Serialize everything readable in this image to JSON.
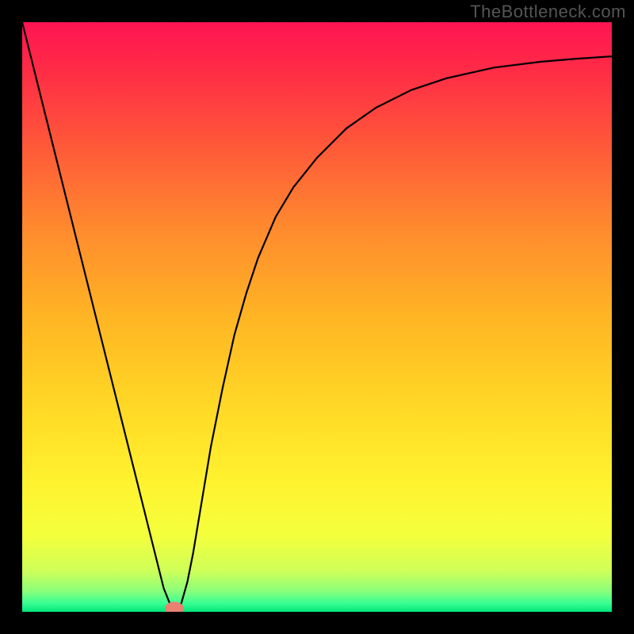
{
  "watermark": "TheBottleneck.com",
  "chart_data": {
    "type": "line",
    "title": "",
    "xlabel": "",
    "ylabel": "",
    "xlim": [
      0,
      100
    ],
    "ylim": [
      0,
      100
    ],
    "background_gradient": {
      "stops": [
        {
          "offset": 0.0,
          "color": "#ff1452"
        },
        {
          "offset": 0.08,
          "color": "#ff2b46"
        },
        {
          "offset": 0.2,
          "color": "#ff553a"
        },
        {
          "offset": 0.35,
          "color": "#ff8a2e"
        },
        {
          "offset": 0.5,
          "color": "#ffb524"
        },
        {
          "offset": 0.65,
          "color": "#ffd825"
        },
        {
          "offset": 0.78,
          "color": "#fff22f"
        },
        {
          "offset": 0.87,
          "color": "#f4ff3c"
        },
        {
          "offset": 0.93,
          "color": "#cfff58"
        },
        {
          "offset": 0.965,
          "color": "#8aff7a"
        },
        {
          "offset": 0.985,
          "color": "#3bff94"
        },
        {
          "offset": 1.0,
          "color": "#00e67a"
        }
      ]
    },
    "series": [
      {
        "name": "bottleneck-curve",
        "color": "#000000",
        "x": [
          0,
          2,
          4,
          6,
          8,
          10,
          12,
          14,
          16,
          18,
          20,
          22,
          23,
          24,
          25,
          25.5,
          26,
          26.5,
          27,
          28,
          29,
          30,
          31,
          32,
          34,
          36,
          38,
          40,
          43,
          46,
          50,
          55,
          60,
          66,
          72,
          80,
          88,
          94,
          100
        ],
        "y": [
          100,
          92,
          84,
          76,
          68,
          60,
          52,
          44,
          36,
          28,
          20,
          12,
          8,
          4,
          1.5,
          0.6,
          0.3,
          0.6,
          1.5,
          5,
          10,
          16,
          22,
          28,
          38,
          47,
          54,
          60,
          67,
          72,
          77,
          82,
          85.5,
          88.5,
          90.5,
          92.3,
          93.3,
          93.8,
          94.2
        ]
      }
    ],
    "marker": {
      "name": "highlight-marker",
      "x": 25.8,
      "y": 0.6,
      "color": "#e98072",
      "rx": 1.6,
      "ry": 1.1
    }
  }
}
